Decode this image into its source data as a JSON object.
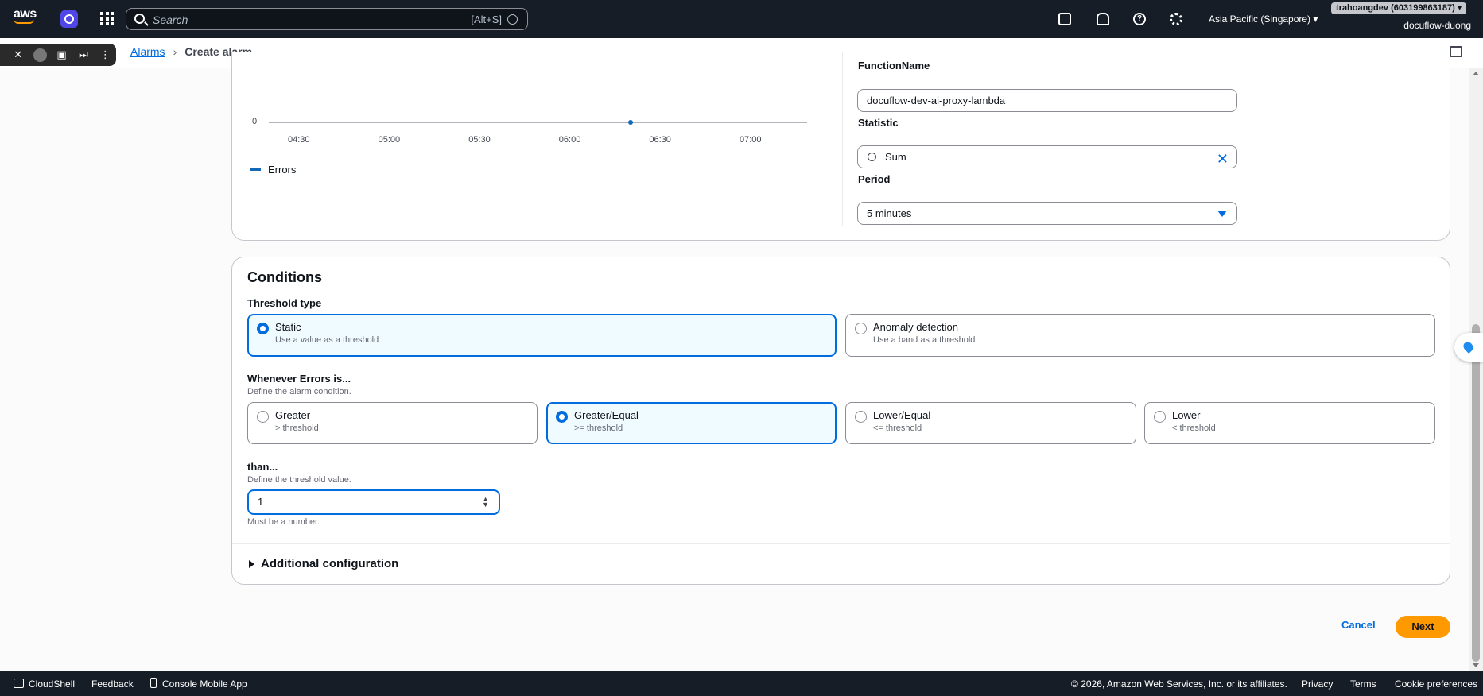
{
  "topnav": {
    "logo_text": "aws",
    "search_placeholder": "Search",
    "search_shortcut": "[Alt+S]",
    "region": "Asia Pacific (Singapore) ▾",
    "account": "trahoangdev (603199863187) ▾",
    "user": "docuflow-duong"
  },
  "breadcrumb": {
    "parent": "Alarms",
    "current": "Create alarm"
  },
  "metric": {
    "chart": {
      "zero_label": "0",
      "ticks": [
        "04:30",
        "05:00",
        "05:30",
        "06:00",
        "06:30",
        "07:00"
      ],
      "legend": "Errors"
    },
    "function_name_label": "FunctionName",
    "function_name_value": "docuflow-dev-ai-proxy-lambda",
    "statistic_label": "Statistic",
    "statistic_value": "Sum",
    "period_label": "Period",
    "period_value": "5 minutes"
  },
  "chart_data": {
    "type": "line",
    "x": [
      "06:20"
    ],
    "series": [
      {
        "name": "Errors",
        "values": [
          0
        ]
      }
    ],
    "ylabel": "",
    "xlabel": "",
    "xticks": [
      "04:30",
      "05:00",
      "05:30",
      "06:00",
      "06:30",
      "07:00"
    ],
    "yticks": [
      "0"
    ],
    "legend": "bottom-left",
    "colors": [
      "#1468b4"
    ]
  },
  "conditions": {
    "title": "Conditions",
    "threshold_type_label": "Threshold type",
    "threshold_types": [
      {
        "title": "Static",
        "desc": "Use a value as a threshold",
        "selected": true
      },
      {
        "title": "Anomaly detection",
        "desc": "Use a band as a threshold",
        "selected": false
      }
    ],
    "whenever_label": "Whenever Errors is...",
    "whenever_desc": "Define the alarm condition.",
    "operators": [
      {
        "title": "Greater",
        "desc": "> threshold",
        "selected": false
      },
      {
        "title": "Greater/Equal",
        "desc": ">= threshold",
        "selected": true
      },
      {
        "title": "Lower/Equal",
        "desc": "<= threshold",
        "selected": false
      },
      {
        "title": "Lower",
        "desc": "< threshold",
        "selected": false
      }
    ],
    "than_label": "than...",
    "than_desc": "Define the threshold value.",
    "threshold_value": "1",
    "threshold_hint": "Must be a number.",
    "additional_config": "Additional configuration"
  },
  "actions": {
    "cancel": "Cancel",
    "next": "Next"
  },
  "footer": {
    "cloudshell": "CloudShell",
    "feedback": "Feedback",
    "mobile_app": "Console Mobile App",
    "copyright": "© 2026, Amazon Web Services, Inc. or its affiliates.",
    "privacy": "Privacy",
    "terms": "Terms",
    "cookies": "Cookie preferences"
  },
  "colors": {
    "accent": "#006ce0",
    "primary_button": "#ff9900",
    "nav_bg": "#161d26",
    "series": "#1468b4"
  }
}
